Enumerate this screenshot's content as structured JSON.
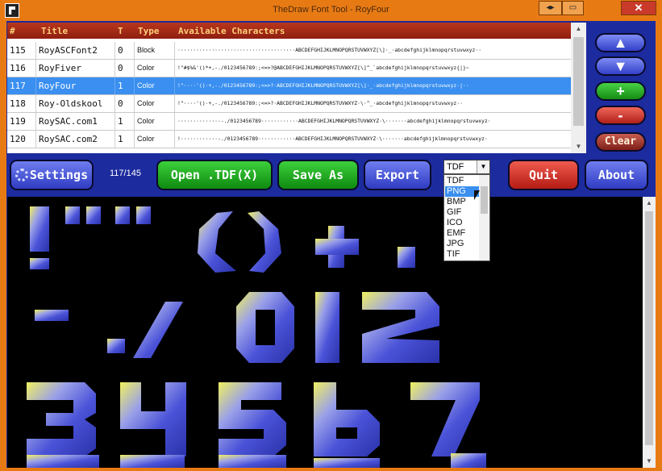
{
  "window": {
    "title": "TheDraw Font Tool - RoyFour",
    "buttons": {
      "restore": "◂▸",
      "minimize": "▭",
      "close": "✕"
    }
  },
  "table": {
    "headers": {
      "id": "#",
      "title": "Title",
      "t": "T",
      "type": "Type",
      "chars": "Available Characters"
    },
    "rows": [
      {
        "id": "115",
        "title": "RoyASCFont2",
        "t": "0",
        "type": "Block",
        "chars": "······································ABCDEFGHIJKLMNOPQRSTUVWXYZ[\\]·_·abcdefghijklmnopqrstuvwxyz··"
      },
      {
        "id": "116",
        "title": "RoyFiver",
        "t": "0",
        "type": "Color",
        "chars": "!\"#$%&'()*+,-./0123456789:;<=>?@ABCDEFGHIJKLMNOPQRSTUVWXYZ[\\]^_`abcdefghijklmnopqrstuvwxyz{|}~"
      },
      {
        "id": "117",
        "title": "RoyFour",
        "t": "1",
        "type": "Color",
        "chars": "!\"····'()·+,-./0123456789:;<=>?·ABCDEFGHIJKLMNOPQRSTUVWXYZ[\\]·_·abcdefghijklmnopqrstuvwxyz·|··"
      },
      {
        "id": "118",
        "title": "Roy-Oldskool",
        "t": "0",
        "type": "Color",
        "chars": "!\"····'()·+,-./0123456789:;<=>?·ABCDEFGHIJKLMNOPQRSTUVWXYZ·\\·^_·abcdefghijklmnopqrstuvwxyz··"
      },
      {
        "id": "119",
        "title": "RoySAC.com1",
        "t": "1",
        "type": "Color",
        "chars": "··············-./0123456789············ABCDEFGHIJKLMNOPQRSTUVWXYZ·\\·······abcdefghijklmnopqrstuvwxyz·"
      },
      {
        "id": "120",
        "title": "RoySAC.com2",
        "t": "1",
        "type": "Color",
        "chars": "!············-./0123456789············ABCDEFGHIJKLMNOPQRSTUVWXYZ·\\·······abcdefghijklmnopqrstuvwxyz·"
      }
    ],
    "selected_index": 2
  },
  "side": {
    "up": "▲",
    "down": "▼",
    "add": "+",
    "remove": "-",
    "clear": "Clear"
  },
  "toolbar": {
    "settings": "Settings",
    "counter": "117/145",
    "open": "Open .TDF(X)",
    "save": "Save As",
    "export": "Export",
    "quit": "Quit",
    "about": "About"
  },
  "format": {
    "selected": "TDF",
    "options": [
      "TDF",
      "PNG",
      "BMP",
      "GIF",
      "ICO",
      "EMF",
      "JPG",
      "TIF"
    ],
    "highlighted": "PNG"
  },
  "colors": {
    "accent": "#1c2b9e",
    "titlebar": "#e87a14",
    "selection": "#3a8ff0",
    "header": "#a82a16"
  }
}
